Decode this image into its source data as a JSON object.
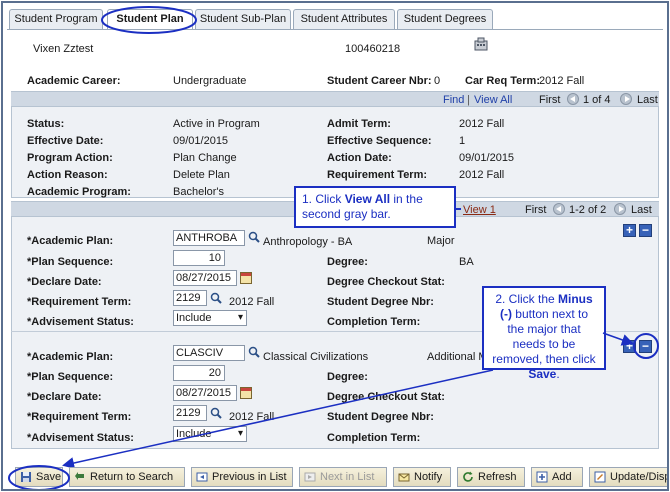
{
  "tabs": [
    {
      "label": "Student Program"
    },
    {
      "label": "Student Plan"
    },
    {
      "label": "Student Sub-Plan"
    },
    {
      "label": "Student Attributes"
    },
    {
      "label": "Student Degrees"
    }
  ],
  "student": {
    "name": "Vixen Zztest",
    "id": "100460218"
  },
  "career": {
    "academic_career_label": "Academic Career:",
    "academic_career_value": "Undergraduate",
    "career_nbr_label": "Student Career Nbr:",
    "career_nbr_value": "0",
    "car_req_term_label": "Car Req Term:",
    "car_req_term_value": "2012 Fall"
  },
  "nav1": {
    "find": "Find",
    "sep": "|",
    "view_all": "View All",
    "first": "First",
    "count": "1 of 4",
    "last": "Last"
  },
  "program": {
    "status_label": "Status:",
    "status_value": "Active in Program",
    "admit_term_label": "Admit Term:",
    "admit_term_value": "2012 Fall",
    "effective_date_label": "Effective Date:",
    "effective_date_value": "09/01/2015",
    "effective_seq_label": "Effective Sequence:",
    "effective_seq_value": "1",
    "program_action_label": "Program Action:",
    "program_action_value": "Plan Change",
    "action_date_label": "Action Date:",
    "action_date_value": "09/01/2015",
    "action_reason_label": "Action Reason:",
    "action_reason_value": "Delete Plan",
    "requirement_term_label": "Requirement Term:",
    "requirement_term_value": "2012 Fall",
    "academic_program_label": "Academic Program:",
    "academic_program_value": "Bachelor's"
  },
  "nav2": {
    "view_1": "View 1",
    "first": "First",
    "count": "1-2 of 2",
    "last": "Last"
  },
  "plan1": {
    "academic_plan_label": "*Academic Plan:",
    "academic_plan_value": "ANTHROBA",
    "academic_plan_desc": "Anthropology - BA",
    "plan_type": "Major",
    "plan_sequence_label": "*Plan Sequence:",
    "plan_sequence_value": "10",
    "degree_label": "Degree:",
    "degree_value": "BA",
    "declare_date_label": "*Declare Date:",
    "declare_date_value": "08/27/2015",
    "degree_checkout_label": "Degree Checkout Stat:",
    "requirement_term_label": "*Requirement Term:",
    "requirement_term_value": "2129",
    "requirement_term_desc": "2012 Fall",
    "student_degree_nbr_label": "Student Degree Nbr:",
    "advisement_label": "*Advisement Status:",
    "advisement_value": "Include",
    "completion_term_label": "Completion Term:"
  },
  "plan2": {
    "academic_plan_label": "*Academic Plan:",
    "academic_plan_value": "CLASCIV",
    "academic_plan_desc": "Classical Civilizations",
    "plan_type": "Additional M",
    "plan_sequence_label": "*Plan Sequence:",
    "plan_sequence_value": "20",
    "degree_label": "Degree:",
    "declare_date_label": "*Declare Date:",
    "declare_date_value": "08/27/2015",
    "degree_checkout_label": "Degree Checkout Stat:",
    "requirement_term_label": "*Requirement Term:",
    "requirement_term_value": "2129",
    "requirement_term_desc": "2012 Fall",
    "student_degree_nbr_label": "Student Degree Nbr:",
    "advisement_label": "*Advisement Status:",
    "advisement_value": "Include",
    "completion_term_label": "Completion Term:"
  },
  "callouts": {
    "one_a": "1. Click ",
    "one_b": "View All",
    "one_c": " in the second gray bar.",
    "two_a": "2. Click the ",
    "two_b": "Minus (-)",
    "two_c": " button next to the major that needs to be removed, then click ",
    "two_d": "Save",
    "two_e": "."
  },
  "toolbar": {
    "save": "Save",
    "return_to_search": "Return to Search",
    "previous_in_list": "Previous in List",
    "next_in_list": "Next in List",
    "notify": "Notify",
    "refresh": "Refresh",
    "add": "Add",
    "update": "Update/Disp"
  },
  "colors": {
    "annotation": "#1b2fc2",
    "link": "#1f3fa8",
    "section_bg": "#eef1f5"
  }
}
